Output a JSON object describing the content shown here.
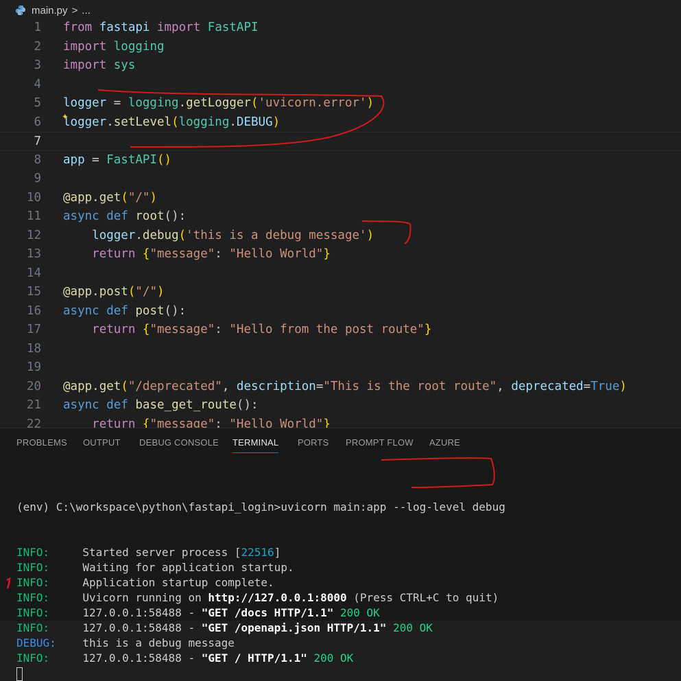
{
  "breadcrumb": {
    "file": "main.py",
    "separator": ">",
    "more": "..."
  },
  "editor": {
    "lines": [
      {
        "n": "1"
      },
      {
        "n": "2"
      },
      {
        "n": "3"
      },
      {
        "n": "4"
      },
      {
        "n": "5"
      },
      {
        "n": "6"
      },
      {
        "n": "7"
      },
      {
        "n": "8"
      },
      {
        "n": "9"
      },
      {
        "n": "10"
      },
      {
        "n": "11"
      },
      {
        "n": "12"
      },
      {
        "n": "13"
      },
      {
        "n": "14"
      },
      {
        "n": "15"
      },
      {
        "n": "16"
      },
      {
        "n": "17"
      },
      {
        "n": "18"
      },
      {
        "n": "19"
      },
      {
        "n": "20"
      },
      {
        "n": "21"
      },
      {
        "n": "22"
      }
    ],
    "code": {
      "l1": [
        "from",
        " ",
        "fastapi",
        " ",
        "import",
        " ",
        "FastAPI"
      ],
      "l2": [
        "import",
        " ",
        "logging"
      ],
      "l3": [
        "import",
        " ",
        "sys"
      ],
      "l5": [
        "logger",
        " = ",
        "logging",
        ".",
        "getLogger",
        "(",
        "'uvicorn.error'",
        ")"
      ],
      "l6": [
        "logger",
        ".",
        "setLevel",
        "(",
        "logging",
        ".",
        "DEBUG",
        ")"
      ],
      "l8": [
        "app",
        " = ",
        "FastAPI",
        "()"
      ],
      "l10": [
        "@",
        "app",
        ".",
        "get",
        "(",
        "\"/\"",
        ")"
      ],
      "l11": [
        "async",
        " ",
        "def",
        " ",
        "root",
        "():"
      ],
      "l12": [
        "    ",
        "logger",
        ".",
        "debug",
        "(",
        "'this is a debug message'",
        ")"
      ],
      "l13": [
        "    ",
        "return",
        " ",
        "{",
        "\"message\"",
        ": ",
        "\"Hello World\"",
        "}"
      ],
      "l15": [
        "@",
        "app",
        ".",
        "post",
        "(",
        "\"/\"",
        ")"
      ],
      "l16": [
        "async",
        " ",
        "def",
        " ",
        "post",
        "():"
      ],
      "l17": [
        "    ",
        "return",
        " ",
        "{",
        "\"message\"",
        ": ",
        "\"Hello from the post route\"",
        "}"
      ],
      "l20": [
        "@",
        "app",
        ".",
        "get",
        "(",
        "\"/deprecated\"",
        ", ",
        "description",
        "=",
        "\"This is the root route\"",
        ", ",
        "deprecated",
        "=",
        "True",
        ")"
      ],
      "l21": [
        "async",
        " ",
        "def",
        " ",
        "base_get_route",
        "():"
      ],
      "l22": [
        "    ",
        "return",
        " ",
        "{",
        "\"message\"",
        ": ",
        "\"Hello World\"",
        "}"
      ]
    }
  },
  "panel": {
    "tabs": [
      "PROBLEMS",
      "OUTPUT",
      "DEBUG CONSOLE",
      "TERMINAL",
      "PORTS",
      "PROMPT FLOW",
      "AZURE"
    ],
    "active_tab": "TERMINAL",
    "terminal": {
      "prompt": "(env) C:\\workspace\\python\\fastapi_login>uvicorn main:app --log-level debug",
      "rows": [
        {
          "level": "INFO:",
          "a": "Started server process [",
          "pid": "22516",
          "b": "]"
        },
        {
          "level": "INFO:",
          "a": "Waiting for application startup."
        },
        {
          "level": "INFO:",
          "a": "Application startup complete."
        },
        {
          "level": "INFO:",
          "a": "Uvicorn running on ",
          "bold": "http://127.0.0.1:8000",
          "b": " (Press CTRL+C to quit)"
        },
        {
          "level": "INFO:",
          "a": "127.0.0.1:58488 - ",
          "bold": "\"GET /docs HTTP/1.1\"",
          "status": " 200 OK"
        },
        {
          "level": "INFO:",
          "a": "127.0.0.1:58488 - ",
          "bold": "\"GET /openapi.json HTTP/1.1\"",
          "status": " 200 OK"
        },
        {
          "level": "DEBUG:",
          "a": "this is a debug message"
        },
        {
          "level": "INFO:",
          "a": "127.0.0.1:58488 - ",
          "bold": "\"GET / HTTP/1.1\"",
          "status": " 200 OK"
        }
      ]
    }
  },
  "colors": {
    "editor_bg": "#1f1f1f",
    "panel_bg": "#181818",
    "annotation": "#d11a1a",
    "info": "#0dbc79",
    "debug": "#3b8eea"
  }
}
